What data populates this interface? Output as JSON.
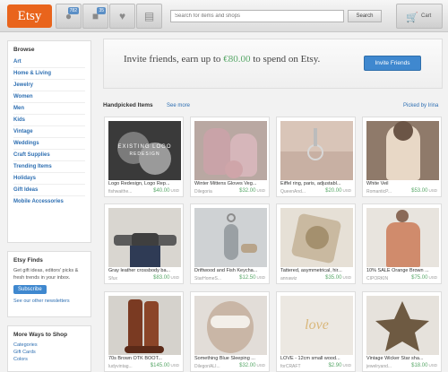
{
  "header": {
    "logo": "Etsy",
    "badges": {
      "activity": "782",
      "messages": "35"
    },
    "search_placeholder": "Search for items and shops",
    "search_button": "Search",
    "cart_label": "Cart",
    "icons": [
      "activity-icon",
      "messages-icon",
      "heart-icon",
      "shop-icon",
      "cart-icon"
    ]
  },
  "sidebar": {
    "browse_title": "Browse",
    "browse_items": [
      "Art",
      "Home & Living",
      "Jewelry",
      "Women",
      "Men",
      "Kids",
      "Vintage",
      "Weddings",
      "Craft Supplies",
      "Trending Items",
      "Holidays",
      "Gift Ideas",
      "Mobile Accessories"
    ],
    "finds_title": "Etsy Finds",
    "finds_text": "Get gift ideas, editors' picks & fresh trends in your inbox.",
    "subscribe_label": "Subscribe",
    "newsletters_link": "See our other newsletters",
    "more_title": "More Ways to Shop",
    "more_items": [
      "Categories",
      "Gift Cards",
      "Colors"
    ]
  },
  "banner": {
    "text_before": "Invite friends, earn up to ",
    "amount": "€80.00",
    "text_after": " to spend on Etsy.",
    "button": "Invite Friends"
  },
  "section": {
    "title": "Handpicked Items",
    "see_more": "See more",
    "picked_by": "Picked by Irina"
  },
  "products": [
    {
      "title": "Logo Redesign, Logo Rep...",
      "shop": "fishwaithe...",
      "price": "$40.00",
      "currency": "USD",
      "thumb_text": "EXISTING LOGO",
      "thumb_sub": "REDESIGN"
    },
    {
      "title": "Winter Mittens Gloves Veg...",
      "shop": "Dilegoria",
      "price": "$32.00",
      "currency": "USD"
    },
    {
      "title": "Eiffel ring, paris, adjustabl...",
      "shop": "QueenAnd...",
      "price": "$20.00",
      "currency": "USD"
    },
    {
      "title": "White Veil",
      "shop": "RomanticP...",
      "price": "$53.00",
      "currency": "USD"
    },
    {
      "title": "Gray leather crossbody ba...",
      "shop": "Sfux",
      "price": "$83.00",
      "currency": "USD"
    },
    {
      "title": "Driftwood and Fish Keycha...",
      "shop": "StarHomeS...",
      "price": "$12.50",
      "currency": "USD"
    },
    {
      "title": "Tattered, asymmetrical, hir...",
      "shop": "annawiz",
      "price": "$35.00",
      "currency": "USD"
    },
    {
      "title": "10% SALE Orange Brown ...",
      "shop": "CIPORKIN",
      "price": "$75.00",
      "currency": "USD"
    },
    {
      "title": "70s Brown OTK BOOT...",
      "shop": "ludyvintag...",
      "price": "$145.00",
      "currency": "USD"
    },
    {
      "title": "Something Blue Sleeping ...",
      "shop": "DilegoriALI...",
      "price": "$32.00",
      "currency": "USD"
    },
    {
      "title": "LOVE - 12cm small wood...",
      "shop": "forCRAFT",
      "price": "$2.90",
      "currency": "USD",
      "thumb_text": "love"
    },
    {
      "title": "Vintage Wicker Star sha...",
      "shop": "jewelryand...",
      "price": "$18.00",
      "currency": "USD"
    }
  ]
}
